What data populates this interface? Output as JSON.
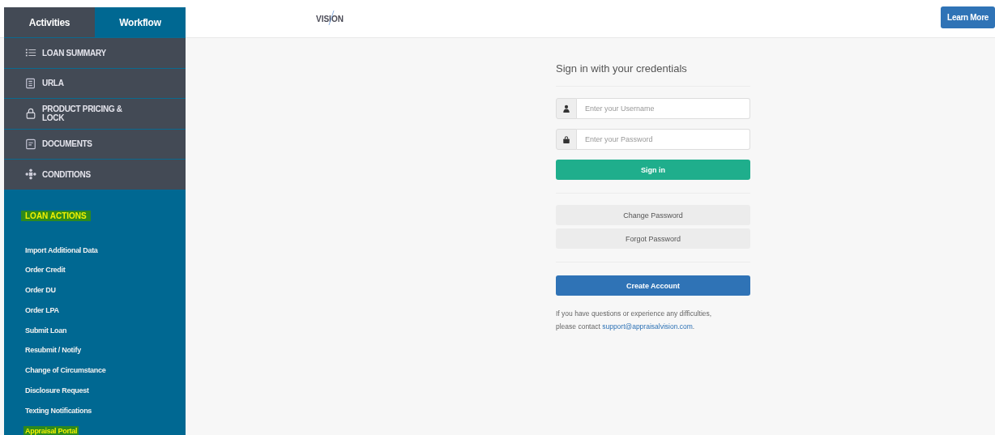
{
  "sidebar": {
    "tabs": [
      {
        "label": "Activities",
        "selected": false
      },
      {
        "label": "Workflow",
        "selected": true
      }
    ],
    "nav": [
      {
        "label": "LOAN SUMMARY",
        "kind": "list"
      },
      {
        "label": "URLA",
        "kind": "form"
      },
      {
        "label": "PRODUCT PRICING & LOCK",
        "kind": "lock"
      },
      {
        "label": "DOCUMENTS",
        "kind": "document"
      },
      {
        "label": "CONDITIONS",
        "kind": "conditions"
      }
    ],
    "actions_heading": {
      "label": "LOAN ACTIONS",
      "highlighted": true
    },
    "actions": [
      {
        "label": "Import Additional Data",
        "highlighted": false
      },
      {
        "label": "Order Credit",
        "highlighted": false
      },
      {
        "label": "Order DU",
        "highlighted": false
      },
      {
        "label": "Order LPA",
        "highlighted": false
      },
      {
        "label": "Submit Loan",
        "highlighted": false
      },
      {
        "label": "Resubmit / Notify",
        "highlighted": false
      },
      {
        "label": "Change of Circumstance",
        "highlighted": false
      },
      {
        "label": "Disclosure Request",
        "highlighted": false
      },
      {
        "label": "Texting Notifications",
        "highlighted": false
      },
      {
        "label": "Appraisal Portal",
        "highlighted": true
      }
    ]
  },
  "header": {
    "logo": "VISION",
    "button": "Learn More"
  },
  "login": {
    "title": "Sign in with your credentials",
    "username": {
      "placeholder": "Enter your Username"
    },
    "password": {
      "placeholder": "Enter your Password"
    },
    "sign_in": "Sign in",
    "change_password": "Change Password",
    "forgot_password": "Forgot Password",
    "create_account": "Create Account",
    "help": {
      "before": "If you have questions or experience any difficulties, please contact ",
      "link": "support@appraisalvision.com",
      "after": "."
    }
  }
}
